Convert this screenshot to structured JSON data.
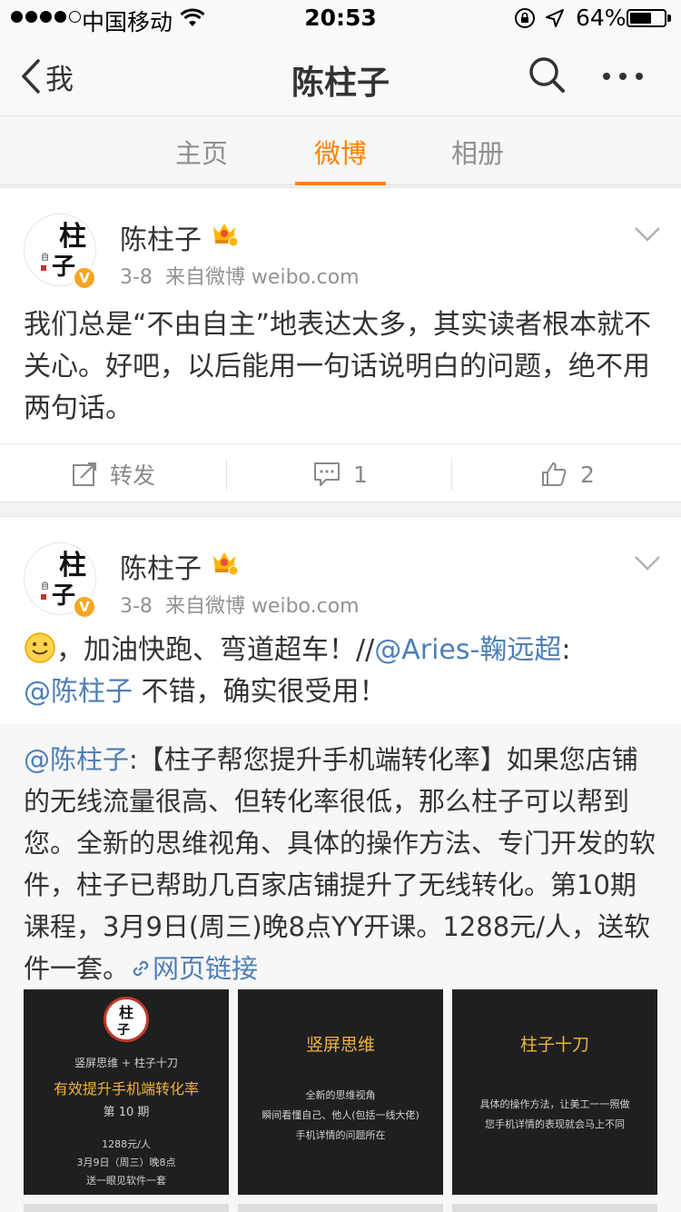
{
  "status_bar": {
    "carrier": "中国移动",
    "time": "20:53",
    "battery_percent": "64%",
    "battery_level": 0.64
  },
  "nav": {
    "back_label": "我",
    "title": "陈柱子"
  },
  "tabs": [
    {
      "label": "主页"
    },
    {
      "label": "微博"
    },
    {
      "label": "相册"
    }
  ],
  "posts": [
    {
      "author": "陈柱子",
      "verified_badge": "V",
      "date": "3-8",
      "source": "来自微博 weibo.com",
      "text": "我们总是“不由自主”地表达太多，其实读者根本就不关心。好吧，以后能用一句话说明白的问题，绝不用两句话。",
      "actions": {
        "repost_label": "转发",
        "comment_count": "1",
        "like_count": "2"
      }
    },
    {
      "author": "陈柱子",
      "verified_badge": "V",
      "date": "3-8",
      "source": "来自微博 weibo.com",
      "text_part1": "，加油快跑、弯道超车！//",
      "mention1": "@Aries-鞠远超",
      "text_colon": ":",
      "mention2": "@陈柱子",
      "text_part2": " 不错，确实很受用！",
      "repost": {
        "mention": "@陈柱子",
        "text": ":【柱子帮您提升手机端转化率】如果您店铺的无线流量很高、但转化率很低，那么柱子可以帮到您。全新的思维视角、具体的操作方法、专门开发的软件，柱子已帮助几百家店铺提升了无线转化。第10期课程，3月9日(周三)晚8点YY开课。1288元/人，送软件一套。",
        "link_label": "网页链接",
        "images": [
          {
            "subtitle": "竖屏思维 + 柱子十刀",
            "title": "有效提升手机端转化率",
            "issue": "第  10  期",
            "price": "1288元/人",
            "date": "3月9日（周三）晚8点",
            "gift": "送一眼见软件一套"
          },
          {
            "title": "竖屏思维",
            "line1": "全新的思维视角",
            "line2": "瞬间看懂自己、他人(包括一线大佬)",
            "line3": "手机详情的问题所在"
          },
          {
            "title": "柱子十刀",
            "line1": "具体的操作方法，让美工一一照做",
            "line2": "您手机详情的表现就会马上不同"
          }
        ]
      }
    }
  ]
}
